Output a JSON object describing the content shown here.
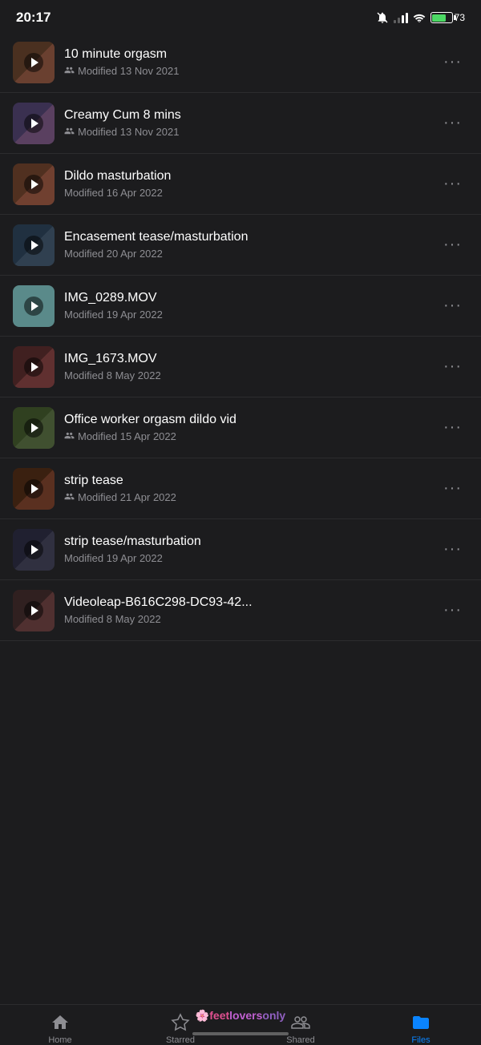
{
  "statusBar": {
    "time": "20:17",
    "battery": "73"
  },
  "files": [
    {
      "name": "10 minute orgasm",
      "meta": "Modified 13 Nov 2021",
      "shared": true,
      "thumbClass": "img-bg1"
    },
    {
      "name": "Creamy Cum 8 mins",
      "meta": "Modified 13 Nov 2021",
      "shared": true,
      "thumbClass": "img-bg2"
    },
    {
      "name": "Dildo masturbation",
      "meta": "Modified 16 Apr 2022",
      "shared": false,
      "thumbClass": "img-bg3"
    },
    {
      "name": "Encasement tease/masturbation",
      "meta": "Modified 20 Apr 2022",
      "shared": false,
      "thumbClass": "img-bg4"
    },
    {
      "name": "IMG_0289.MOV",
      "meta": "Modified 19 Apr 2022",
      "shared": false,
      "thumbClass": "teal-bg"
    },
    {
      "name": "IMG_1673.MOV",
      "meta": "Modified 8 May 2022",
      "shared": false,
      "thumbClass": "img-bg6"
    },
    {
      "name": "Office worker orgasm dildo vid",
      "meta": "Modified 15 Apr 2022",
      "shared": true,
      "thumbClass": "img-bg7"
    },
    {
      "name": "strip tease",
      "meta": "Modified 21 Apr 2022",
      "shared": true,
      "thumbClass": "img-bg8"
    },
    {
      "name": "strip tease/masturbation",
      "meta": "Modified 19 Apr 2022",
      "shared": false,
      "thumbClass": "img-bg9"
    },
    {
      "name": "Videoleap-B616C298-DC93-42...",
      "meta": "Modified 8 May 2022",
      "shared": false,
      "thumbClass": "img-bg10"
    }
  ],
  "nav": {
    "home": "Home",
    "starred": "Starred",
    "shared": "Shared",
    "files": "Files"
  },
  "brand": {
    "emoji": "🌸",
    "text": "feetloversonly"
  }
}
